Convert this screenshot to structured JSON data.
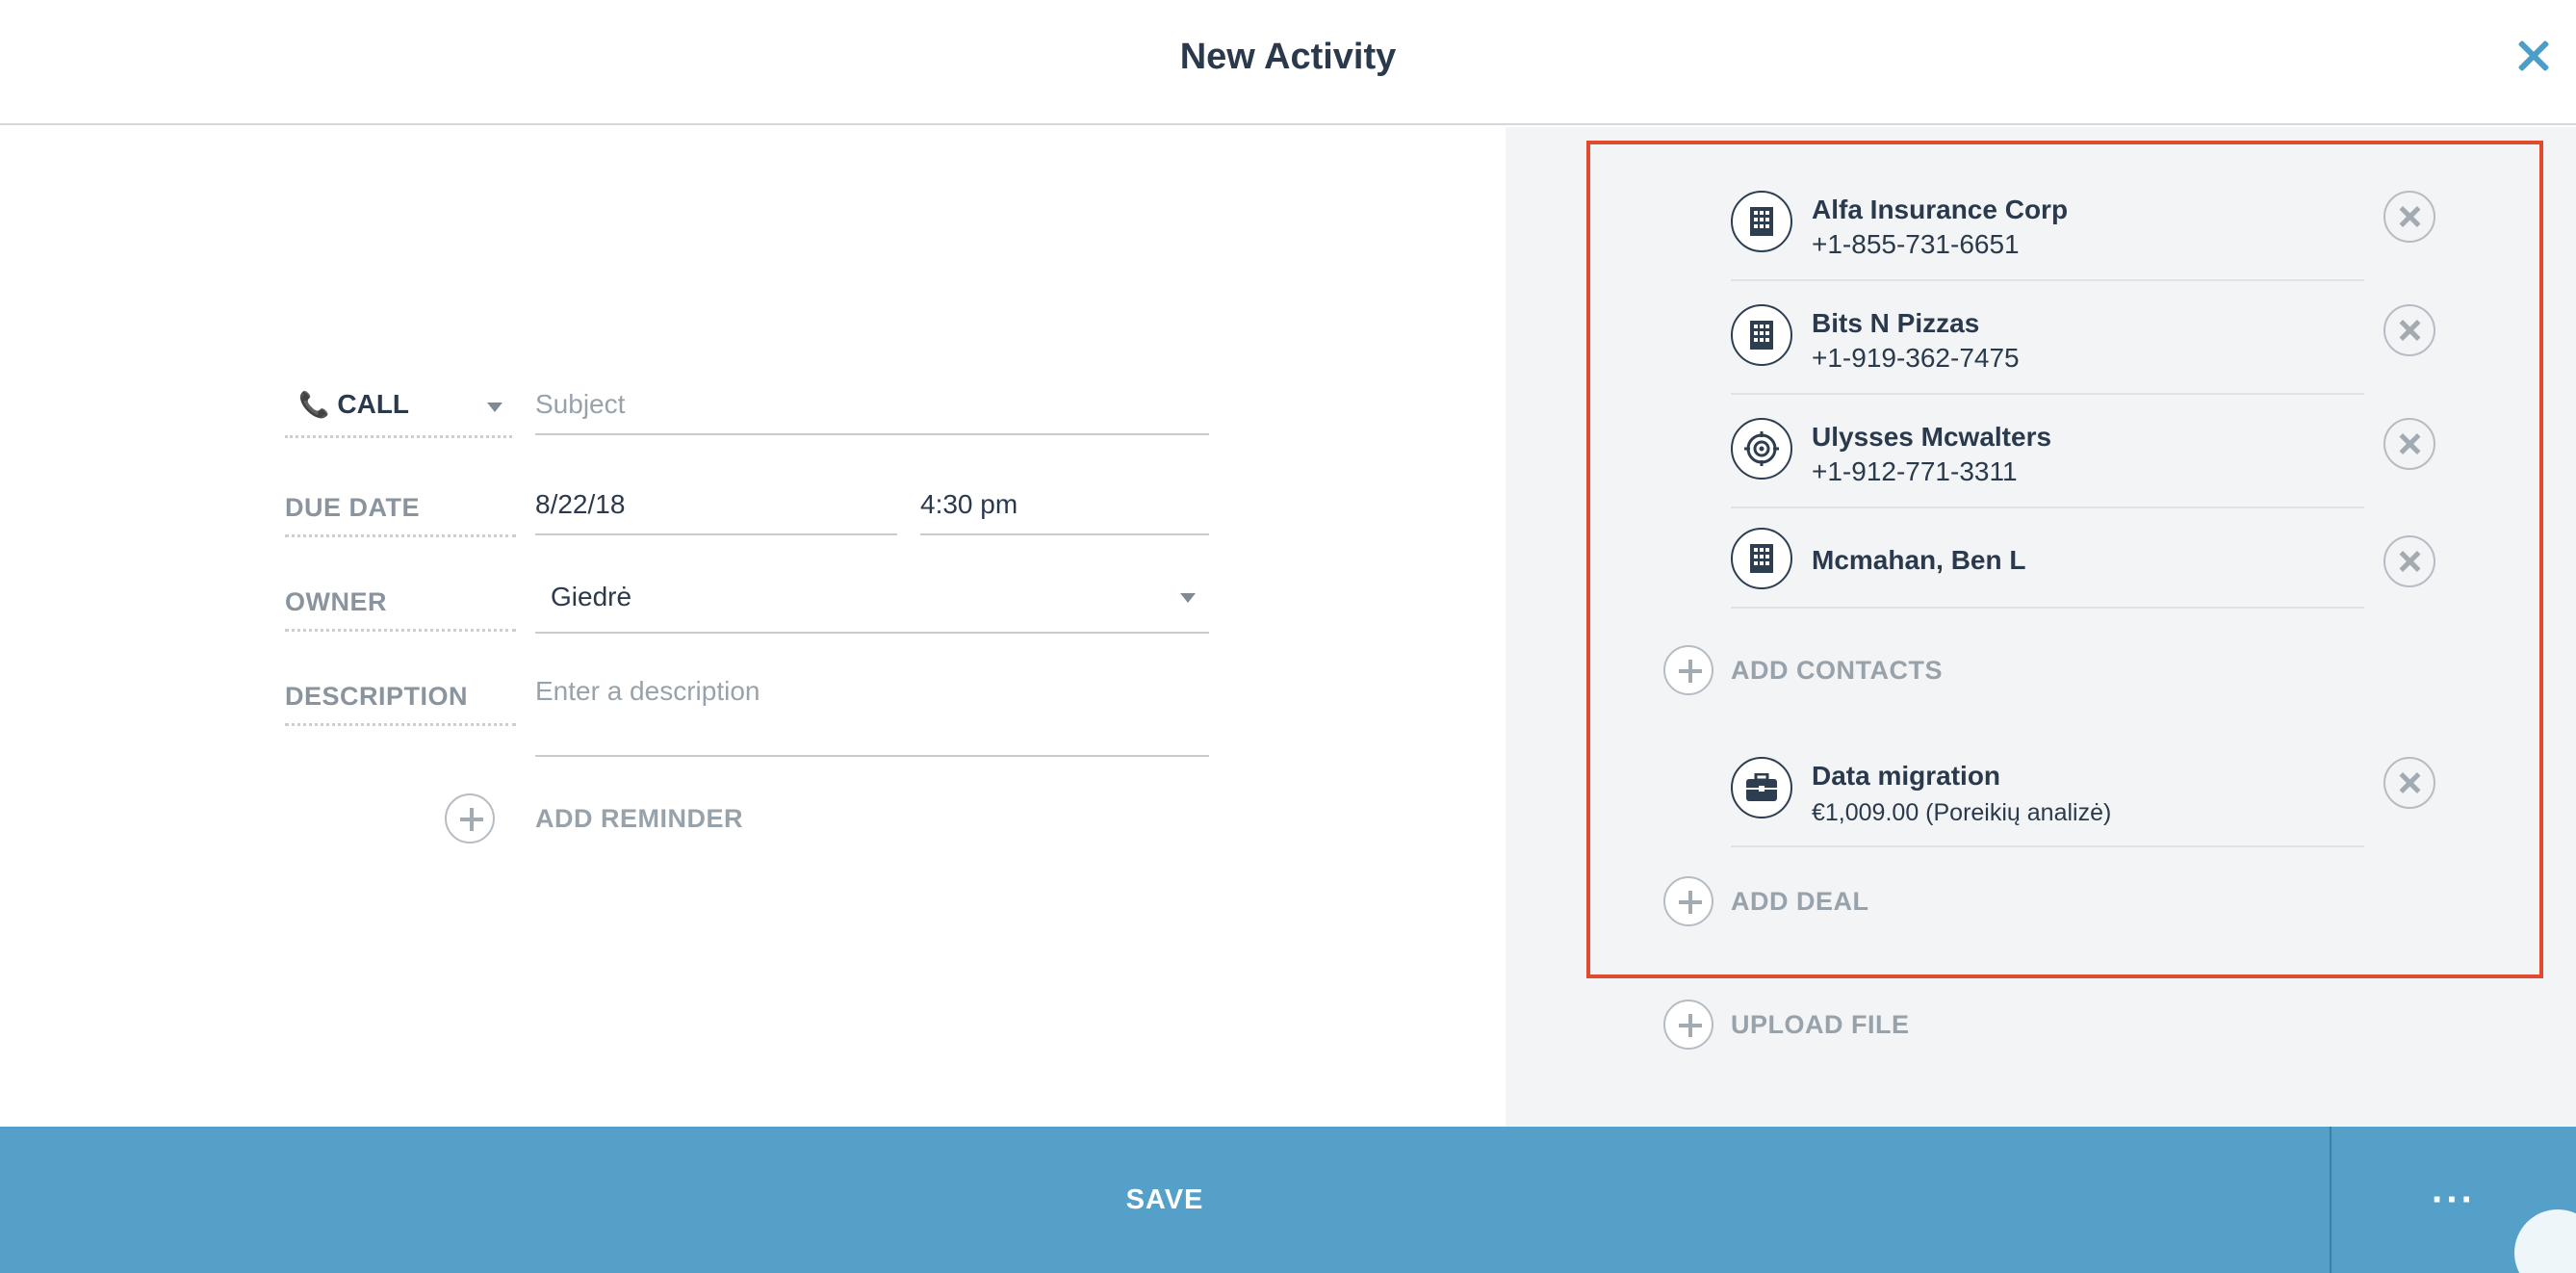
{
  "header": {
    "title": "New Activity"
  },
  "form": {
    "type_label": "CALL",
    "subject_placeholder": "Subject",
    "due_date_label": "DUE DATE",
    "due_date_value": "8/22/18",
    "due_time_value": "4:30 pm",
    "owner_label": "OWNER",
    "owner_value": "Giedrė",
    "description_label": "DESCRIPTION",
    "description_placeholder": "Enter a description",
    "add_reminder": "ADD REMINDER"
  },
  "contacts": [
    {
      "name": "Alfa Insurance Corp",
      "phone": "+1-855-731-6651",
      "icon": "building-icon"
    },
    {
      "name": "Bits N Pizzas",
      "phone": "+1-919-362-7475",
      "icon": "building-icon"
    },
    {
      "name": "Ulysses Mcwalters",
      "phone": "+1-912-771-3311",
      "icon": "target-icon"
    },
    {
      "name": "Mcmahan, Ben L",
      "phone": "",
      "icon": "building-icon"
    }
  ],
  "add_contacts": "ADD CONTACTS",
  "deal": {
    "name": "Data migration",
    "detail": "€1,009.00 (Poreikių analizė)",
    "icon": "briefcase-icon"
  },
  "add_deal": "ADD DEAL",
  "upload_file": "UPLOAD FILE",
  "footer": {
    "save": "SAVE",
    "more": "···"
  },
  "colors": {
    "accent": "#55a0c8",
    "highlight": "#e04a2f",
    "close": "#4d9dc9"
  }
}
